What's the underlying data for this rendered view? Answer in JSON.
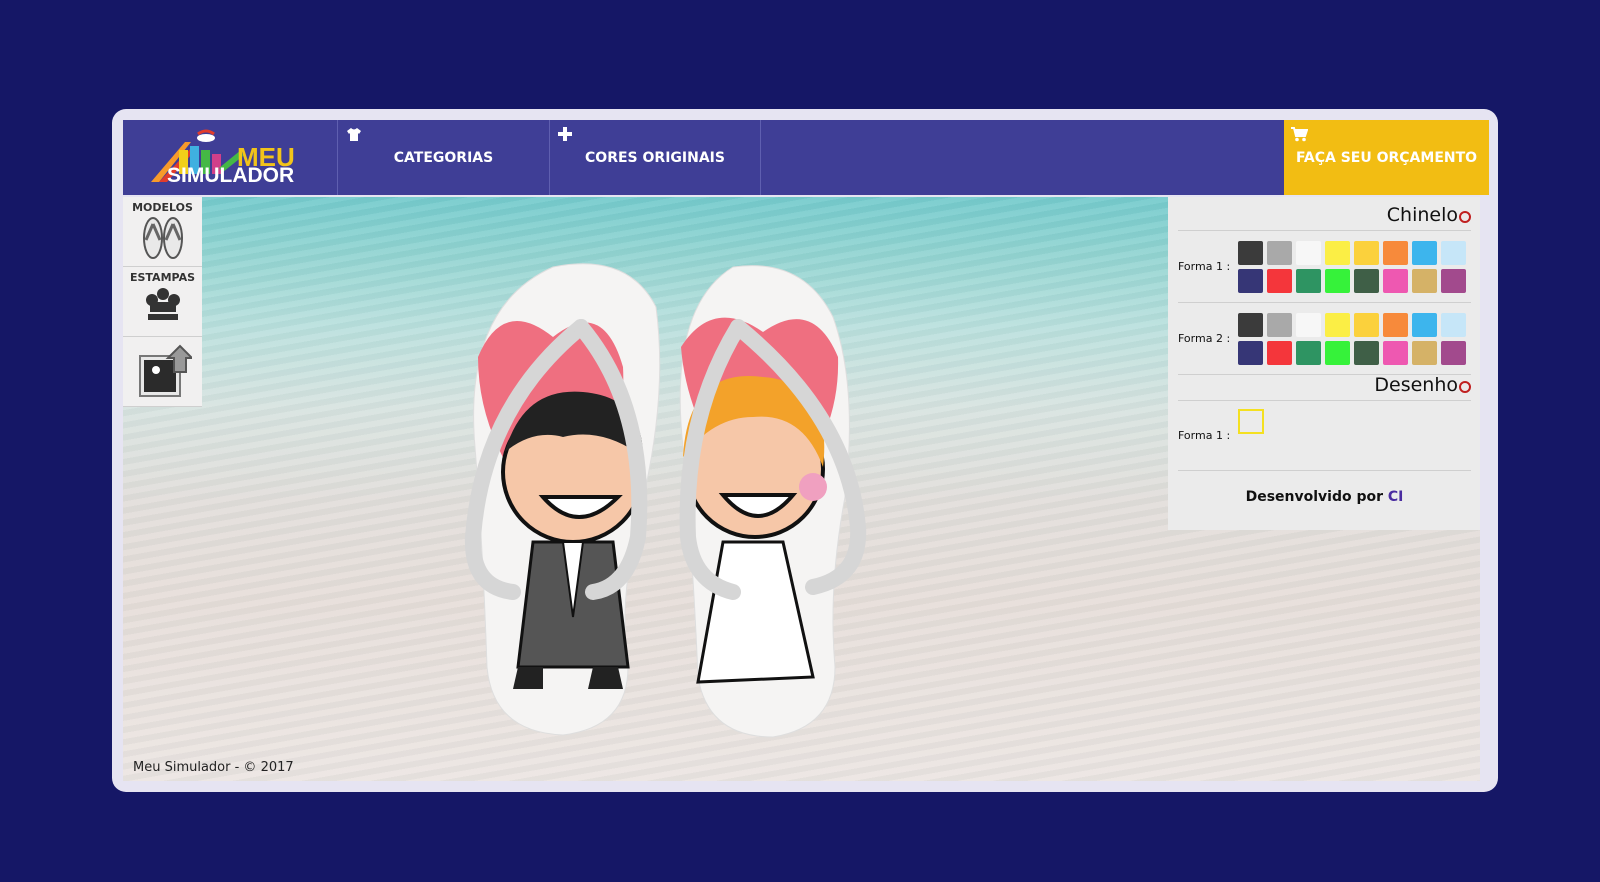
{
  "header": {
    "logo_line1": "MEU",
    "logo_line2": "SIMULADOR",
    "nav": [
      {
        "label": "CATEGORIAS",
        "icon": "shirt-icon"
      },
      {
        "label": "CORES ORIGINAIS",
        "icon": "plus-icon"
      }
    ],
    "quote_label": "FAÇA SEU ORÇAMENTO",
    "quote_icon": "cart-icon"
  },
  "tools": [
    {
      "label": "MODELOS",
      "icon": "flip-flops-icon"
    },
    {
      "label": "ESTAMPAS",
      "icon": "crown-icon"
    },
    {
      "label": "",
      "icon": "upload-image-icon"
    }
  ],
  "footer": "Meu Simulador - © 2017",
  "panel": {
    "chinelo_title": "Chinelo",
    "desenho_title": "Desenho",
    "forma1_label": "Forma 1 :",
    "forma2_label": "Forma 2 :",
    "desenho_forma1_label": "Forma 1 :",
    "credit_prefix": "Desenvolvido por",
    "credit_link": "CI"
  },
  "colors": {
    "swatches": [
      "#3b3b3b",
      "#a9a9a9",
      "#f7f7f7",
      "#fbee45",
      "#fbd13c",
      "#f78a3b",
      "#3db5ed",
      "#c6e6f8",
      "#363676",
      "#f4363b",
      "#2e9462",
      "#36f23a",
      "#3f5f47",
      "#ee58b1",
      "#d5b267",
      "#a24a8d"
    ],
    "accent": "#3f3e96",
    "quote": "#f2bd13"
  }
}
